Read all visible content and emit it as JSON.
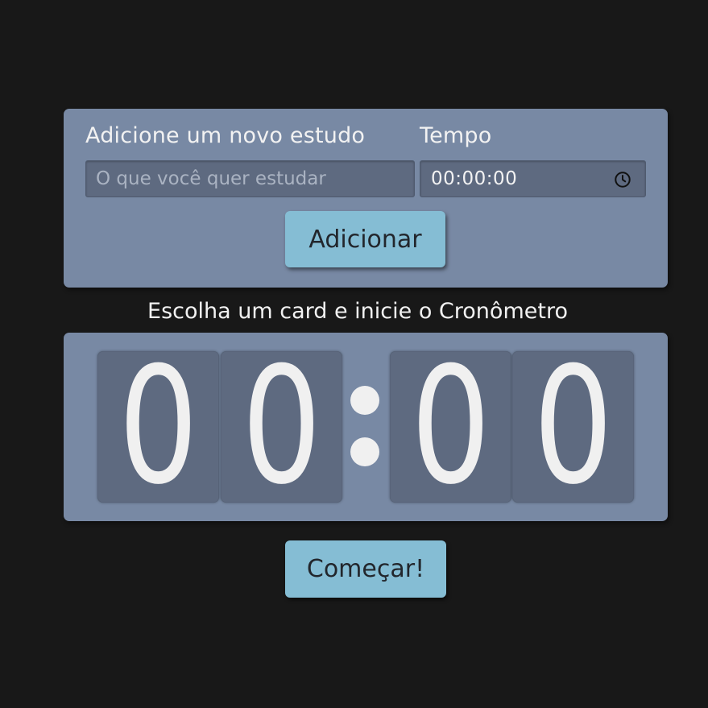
{
  "form": {
    "task_label": "Adicione um novo estudo",
    "time_label": "Tempo",
    "task_placeholder": "O que você quer estudar",
    "task_value": "",
    "time_value": "00:00:00",
    "add_button": "Adicionar",
    "time_icon": "clock-icon"
  },
  "timer": {
    "prompt": "Escolha um card e inicie o Cronômetro",
    "digits": [
      "0",
      "0",
      "0",
      "0"
    ],
    "separator": ":",
    "start_button": "Começar!"
  },
  "colors": {
    "background": "#181818",
    "card": "#7889a4",
    "field": "#5e6a80",
    "button": "#85bdd4",
    "text_light": "#f2f2f2",
    "text_dark": "#22262c"
  }
}
